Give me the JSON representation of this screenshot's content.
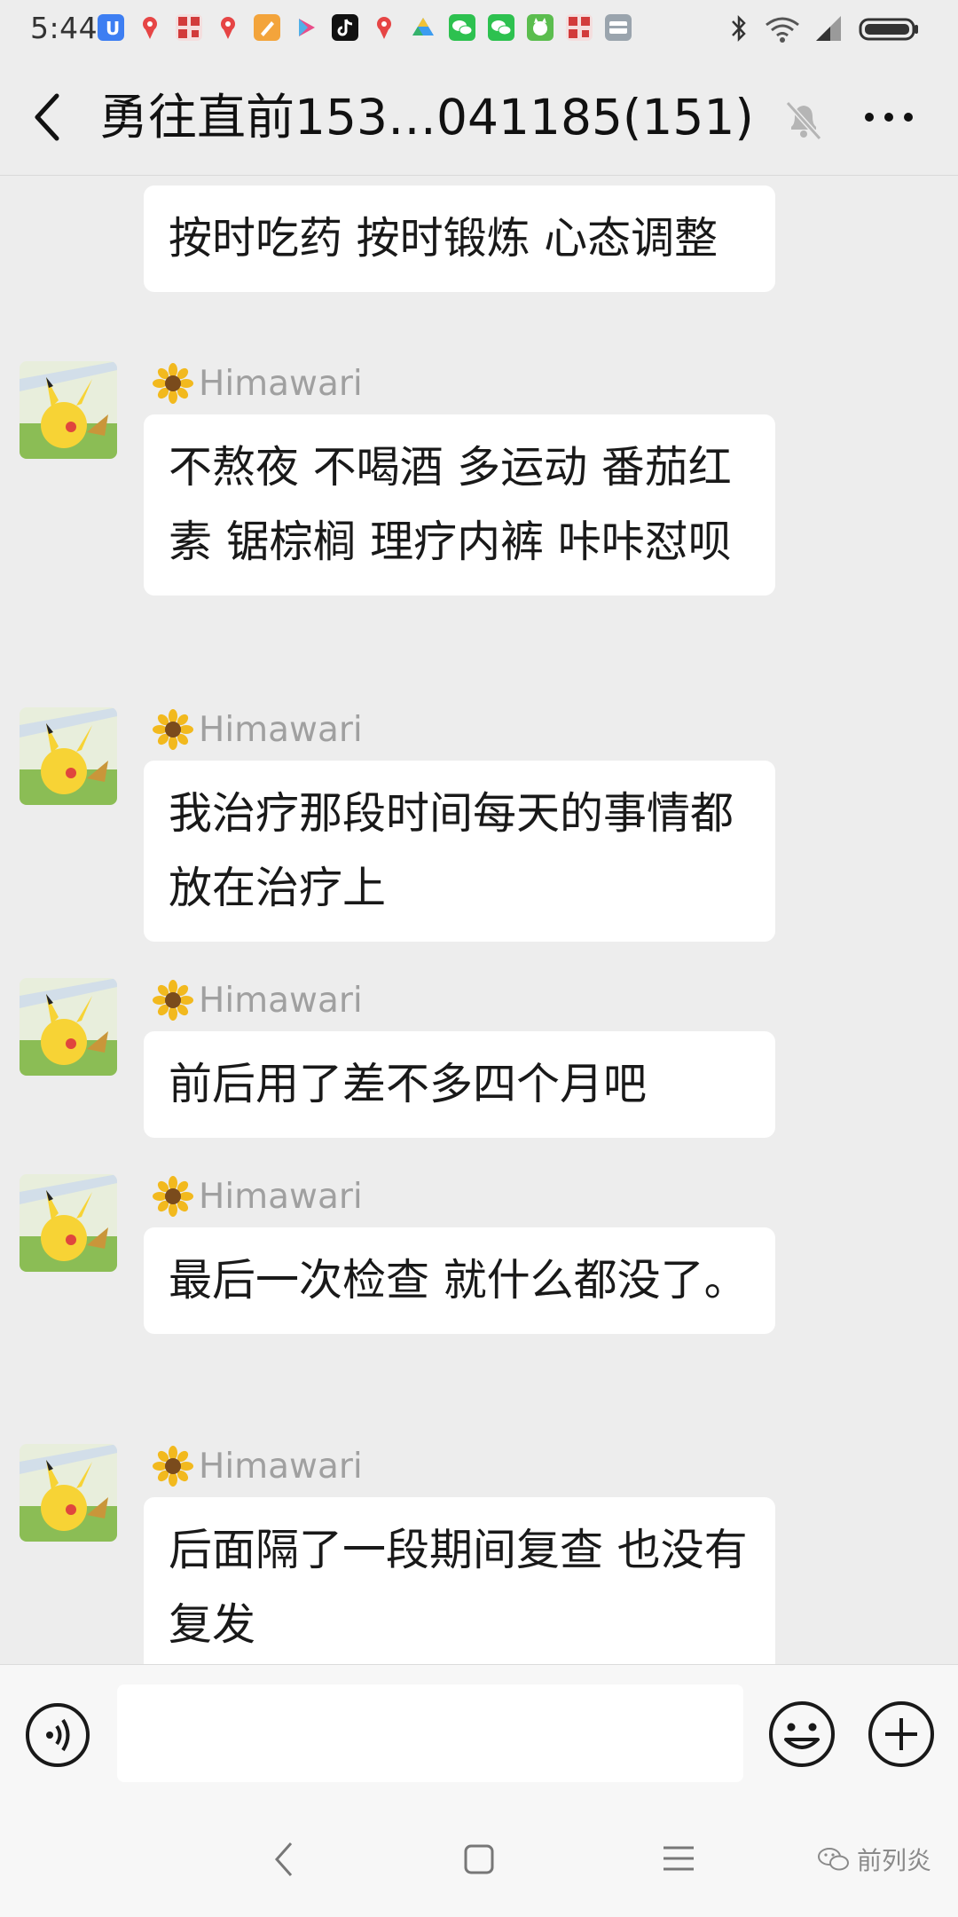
{
  "status_bar": {
    "time": "5:44",
    "notification_icons": [
      "u-app-icon",
      "map-pin-icon",
      "qr-app-icon",
      "map-pin-icon",
      "brush-app-icon",
      "play-store-icon",
      "tiktok-icon",
      "map-pin-icon",
      "drive-icon",
      "wechat-icon",
      "wechat-icon",
      "cat-app-icon",
      "qr-app-icon",
      "tray-icon"
    ],
    "system_icons": [
      "bluetooth-icon",
      "wifi-icon",
      "signal-icon",
      "battery-icon"
    ]
  },
  "header": {
    "title": "勇往直前153…041185(151)",
    "back_icon": "chevron-left-icon",
    "mute_icon": "bell-off-icon",
    "more_icon": "more-dots-icon"
  },
  "messages": [
    {
      "sender": "",
      "text": "按时吃药  按时锻炼 心态调整"
    },
    {
      "sender": "Himawari",
      "text": "不熬夜 不喝酒 多运动 番茄红素 锯棕榈 理疗内裤 咔咔怼呗"
    },
    {
      "sender": "Himawari",
      "text": "我治疗那段时间每天的事情都放在治疗上"
    },
    {
      "sender": "Himawari",
      "text": "前后用了差不多四个月吧"
    },
    {
      "sender": "Himawari",
      "text": "最后一次检查  就什么都没了。"
    },
    {
      "sender": "Himawari",
      "text": "后面隔了一段期间复查 也没有复发"
    }
  ],
  "input_bar": {
    "voice_icon": "voice-icon",
    "text_value": "",
    "emoji_icon": "emoji-icon",
    "plus_icon": "plus-icon"
  },
  "system_nav": {
    "back_icon": "nav-back-icon",
    "home_icon": "nav-home-icon",
    "menu_icon": "nav-menu-icon"
  },
  "watermark": {
    "text": "前列炎",
    "icon": "wechat-watermark-icon"
  },
  "colors": {
    "background": "#ededed",
    "bubble": "#ffffff",
    "sender_name": "#a0a0a0",
    "text": "#191919"
  }
}
